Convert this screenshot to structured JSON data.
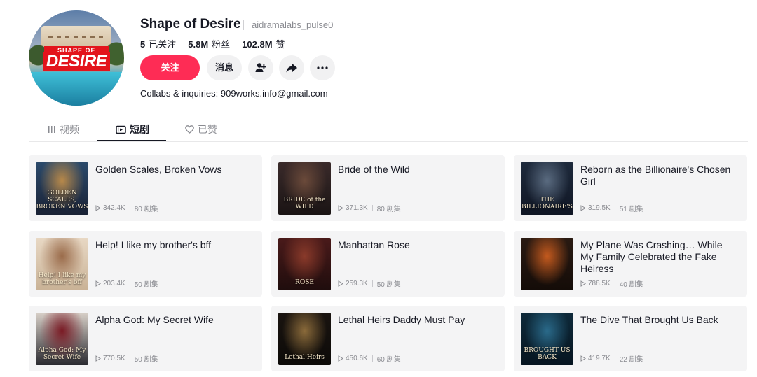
{
  "profile": {
    "name": "Shape of Desire",
    "handle": "aidramalabs_pulse0",
    "bio": "Collabs & inquiries: 909works.info@gmail.com",
    "avatar_logo_top": "SHAPE OF",
    "avatar_logo_main": "DESIRE"
  },
  "stats": {
    "following_count": "5",
    "following_label": "已关注",
    "followers_count": "5.8M",
    "followers_label": "粉丝",
    "likes_count": "102.8M",
    "likes_label": "赞"
  },
  "actions": {
    "follow_label": "关注",
    "message_label": "消息"
  },
  "tabs": [
    {
      "label": "视频",
      "icon": "grid-icon"
    },
    {
      "label": "短剧",
      "icon": "series-icon",
      "active": true
    },
    {
      "label": "已赞",
      "icon": "heart-icon"
    }
  ],
  "dramas": [
    {
      "title": "Golden Scales, Broken Vows",
      "plays": "342.4K",
      "episodes": "80 剧集",
      "thumb_text": "GOLDEN SCALES, BROKEN VOWS",
      "thumb_colors": [
        "#2b4a6b",
        "#b8894a",
        "#1a2235"
      ]
    },
    {
      "title": "Bride of the Wild",
      "plays": "371.3K",
      "episodes": "80 剧集",
      "thumb_text": "BRIDE of the WILD",
      "thumb_colors": [
        "#3a2a2a",
        "#6b4a3a",
        "#1a1414"
      ]
    },
    {
      "title": "Reborn as the Billionaire's Chosen Girl",
      "plays": "319.5K",
      "episodes": "51 剧集",
      "thumb_text": "THE BILLIONAIRE'S",
      "thumb_colors": [
        "#1e2a3c",
        "#5a6b80",
        "#101624"
      ]
    },
    {
      "title": "Help! I like my brother's bff",
      "plays": "203.4K",
      "episodes": "50 剧集",
      "thumb_text": "Help! I like my brother's bff",
      "thumb_colors": [
        "#e8d8c4",
        "#9a6b4a",
        "#c9b296"
      ]
    },
    {
      "title": "Manhattan Rose",
      "plays": "259.3K",
      "episodes": "50 剧集",
      "thumb_text": "ROSE",
      "thumb_colors": [
        "#4a1a1a",
        "#8a3a2a",
        "#1f0d0d"
      ]
    },
    {
      "title": "My Plane Was Crashing… While My Family Celebrated the Fake Heiress",
      "plays": "788.5K",
      "episodes": "40 剧集",
      "thumb_text": "",
      "thumb_colors": [
        "#2a1a12",
        "#c45a1e",
        "#140c08"
      ]
    },
    {
      "title": "Alpha God: My Secret Wife",
      "plays": "770.5K",
      "episodes": "50 剧集",
      "thumb_text": "Alpha God: My Secret Wife",
      "thumb_colors": [
        "#d8d0c8",
        "#7a1a24",
        "#2a2a30"
      ]
    },
    {
      "title": "Lethal Heirs Daddy Must Pay",
      "plays": "450.6K",
      "episodes": "60 剧集",
      "thumb_text": "Lethal Heirs",
      "thumb_colors": [
        "#1a1410",
        "#8a6a3a",
        "#0c0a08"
      ]
    },
    {
      "title": "The Dive That Brought Us Back",
      "plays": "419.7K",
      "episodes": "22 剧集",
      "thumb_text": "BROUGHT US BACK",
      "thumb_colors": [
        "#0e2a3a",
        "#2a6a8a",
        "#061420"
      ]
    }
  ]
}
